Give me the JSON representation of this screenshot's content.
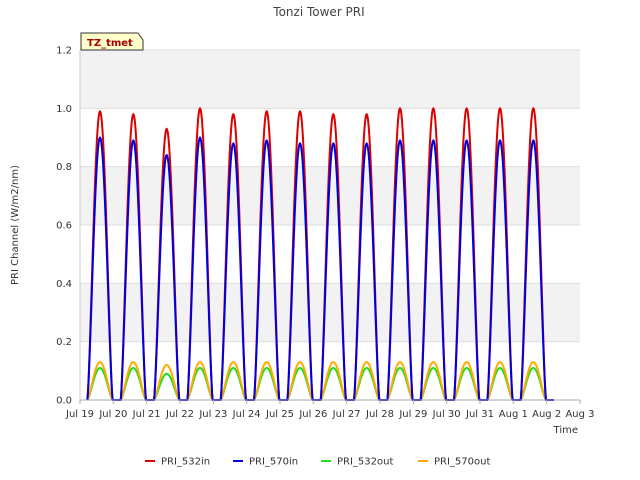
{
  "chart_data": {
    "type": "line",
    "title": "Tonzi Tower PRI",
    "badge": "TZ_tmet",
    "xlabel": "Time",
    "ylabel": "PRI Channel (W/m2/nm)",
    "xlim": [
      0,
      15
    ],
    "ylim": [
      0,
      1.2
    ],
    "yticks": [
      0.0,
      0.2,
      0.4,
      0.6,
      0.8,
      1.0,
      1.2
    ],
    "ytick_labels": [
      "0.0",
      "0.2",
      "0.4",
      "0.6",
      "0.8",
      "1.0",
      "1.2"
    ],
    "xtick_labels": [
      "Jul 19",
      "Jul 20",
      "Jul 21",
      "Jul 22",
      "Jul 23",
      "Jul 24",
      "Jul 25",
      "Jul 26",
      "Jul 27",
      "Jul 28",
      "Jul 29",
      "Jul 30",
      "Jul 31",
      "Aug 1",
      "Aug 2",
      "Aug 3"
    ],
    "background_bands": true,
    "legend_position": "bottom",
    "days": [
      "Jul 19",
      "Jul 20",
      "Jul 21",
      "Jul 22",
      "Jul 23",
      "Jul 24",
      "Jul 25",
      "Jul 26",
      "Jul 27",
      "Jul 28",
      "Jul 29",
      "Jul 30",
      "Jul 31",
      "Aug 1"
    ],
    "series": [
      {
        "name": "PRI_532in",
        "color": "#dd0000",
        "daily_peak": [
          0.99,
          0.98,
          0.93,
          1.0,
          0.98,
          0.99,
          0.99,
          0.98,
          0.98,
          1.0,
          1.0,
          1.0,
          1.0,
          1.0
        ]
      },
      {
        "name": "PRI_570in",
        "color": "#0000dd",
        "daily_peak": [
          0.9,
          0.89,
          0.84,
          0.9,
          0.88,
          0.89,
          0.88,
          0.88,
          0.88,
          0.89,
          0.89,
          0.89,
          0.89,
          0.89
        ]
      },
      {
        "name": "PRI_532out",
        "color": "#22dd22",
        "daily_peak": [
          0.11,
          0.11,
          0.09,
          0.11,
          0.11,
          0.11,
          0.11,
          0.11,
          0.11,
          0.11,
          0.11,
          0.11,
          0.11,
          0.11
        ]
      },
      {
        "name": "PRI_570out",
        "color": "#ffaa00",
        "daily_peak": [
          0.13,
          0.13,
          0.12,
          0.13,
          0.13,
          0.13,
          0.13,
          0.13,
          0.13,
          0.13,
          0.13,
          0.13,
          0.13,
          0.13
        ]
      }
    ]
  }
}
